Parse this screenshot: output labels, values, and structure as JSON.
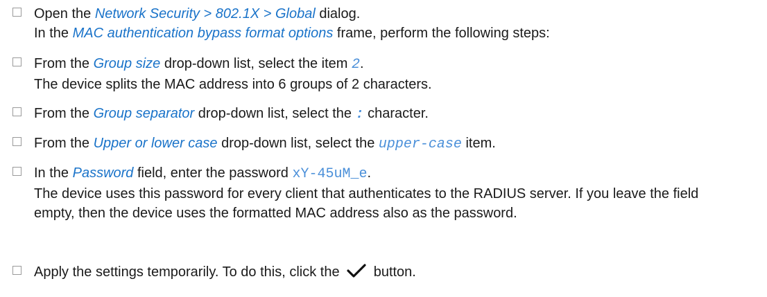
{
  "steps": [
    {
      "a": "Open the ",
      "b": "Network Security > 802.1X > Global",
      "c": " dialog.",
      "line2_a": "In the ",
      "line2_b": "MAC authentication bypass format options",
      "line2_c": " frame, perform the following steps:"
    },
    {
      "a": "From the ",
      "b": "Group size",
      "c": " drop-down list, select the item ",
      "d": "2",
      "e": ".",
      "line2": "The device splits the MAC address into 6 groups of 2 characters."
    },
    {
      "a": "From the ",
      "b": "Group separator",
      "c": " drop-down list, select the ",
      "d": ":",
      "e": " character."
    },
    {
      "a": "From the ",
      "b": "Upper or lower case",
      "c": " drop-down list, select the ",
      "d": "upper-case",
      "e": " item."
    },
    {
      "a": "In the ",
      "b": "Password",
      "c": " field, enter the password ",
      "d": "xY-45uM_e",
      "e": ".",
      "line2": "The device uses this password for every client that authenticates to the RADIUS server. If you leave the field empty, then the device uses the formatted MAC address also as the password."
    },
    {
      "a": "Apply the settings temporarily. To do this, click the ",
      "icon": "checkmark-icon",
      "c": " button."
    }
  ]
}
